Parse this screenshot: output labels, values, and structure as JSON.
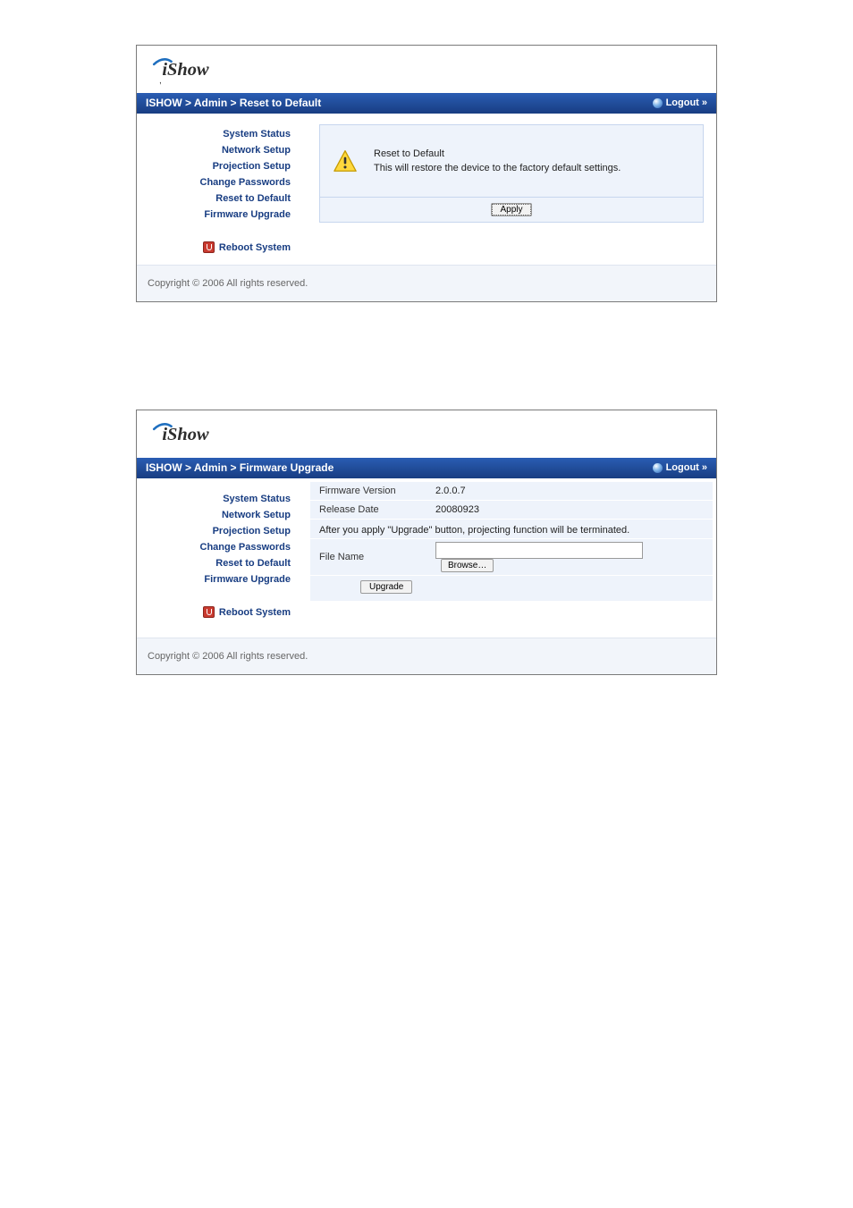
{
  "logo_text": "iShow",
  "panel1": {
    "breadcrumb": "ISHOW > Admin > Reset to Default",
    "logout": "Logout »",
    "sidebar": {
      "items": [
        "System Status",
        "Network Setup",
        "Projection Setup",
        "Change Passwords",
        "Reset to Default",
        "Firmware Upgrade"
      ],
      "reboot": "Reboot System"
    },
    "content": {
      "title": "Reset to Default",
      "desc": "This will restore the device to the factory default settings.",
      "apply": "Apply"
    }
  },
  "panel2": {
    "breadcrumb": "ISHOW > Admin > Firmware Upgrade",
    "logout": "Logout »",
    "sidebar": {
      "items": [
        "System Status",
        "Network Setup",
        "Projection Setup",
        "Change Passwords",
        "Reset to Default",
        "Firmware Upgrade"
      ],
      "reboot": "Reboot System"
    },
    "content": {
      "rows": [
        {
          "label": "Firmware Version",
          "value": "2.0.0.7"
        },
        {
          "label": "Release Date",
          "value": "20080923"
        }
      ],
      "note": "After you apply \"Upgrade\" button, projecting function will be terminated.",
      "file_label": "File Name",
      "browse": "Browse…",
      "upgrade": "Upgrade"
    }
  },
  "footer": "Copyright © 2006 All rights reserved."
}
